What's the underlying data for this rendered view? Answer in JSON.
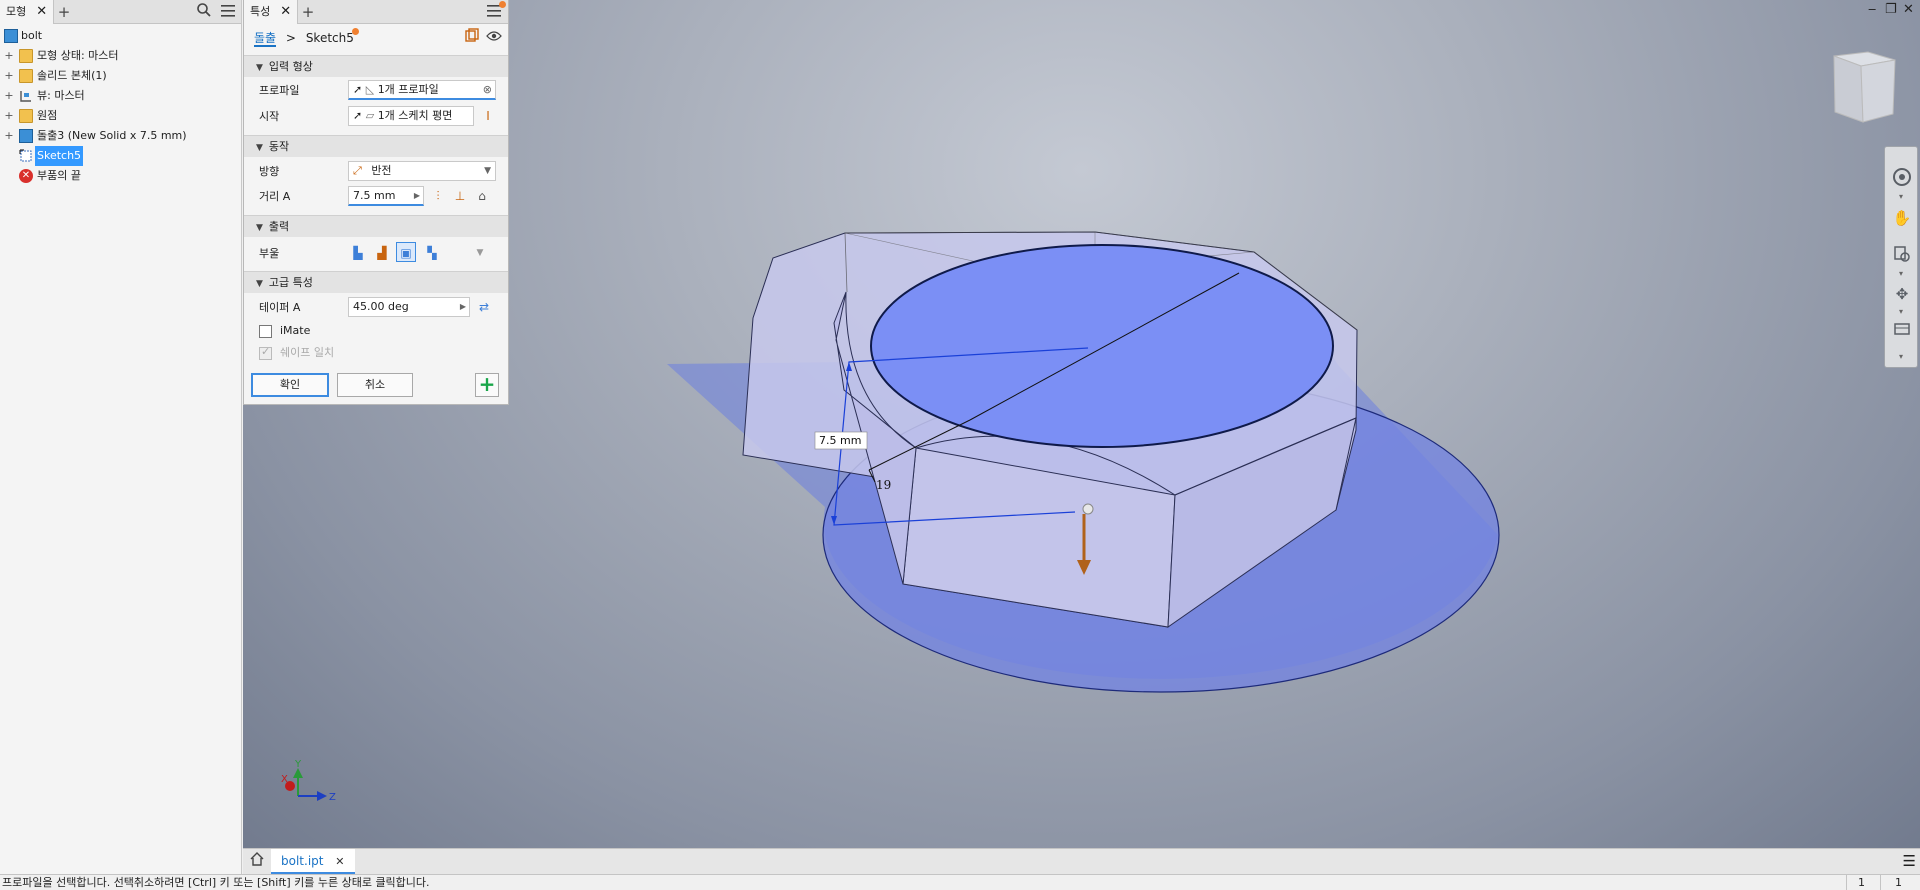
{
  "browser": {
    "tab_label": "모형",
    "close_glyph": "✕",
    "add_glyph": "+",
    "search_icon": "search-icon",
    "menu_icon": "hamburger-icon",
    "tree": [
      {
        "label": "bolt",
        "icon": "part-icon"
      },
      {
        "label": "모형 상태: 마스터",
        "icon": "folder-icon",
        "expand": "+"
      },
      {
        "label": "솔리드 본체(1)",
        "icon": "folder-icon",
        "expand": "+"
      },
      {
        "label": "뷰: 마스터",
        "icon": "view-icon",
        "expand": "+"
      },
      {
        "label": "원점",
        "icon": "folder-icon",
        "expand": "+"
      },
      {
        "label": "돌출3 (New Solid x 7.5 mm)",
        "icon": "extrude-icon",
        "expand": "+"
      },
      {
        "label": "Sketch5",
        "icon": "sketch-icon"
      },
      {
        "label": "부품의 끝",
        "icon": "end-of-part-icon"
      }
    ]
  },
  "properties": {
    "tab_label": "특성",
    "close_glyph": "✕",
    "add_glyph": "+",
    "breadcrumb": {
      "parent": "돌출",
      "separator": ">",
      "current": "Sketch5"
    },
    "sections": {
      "input_geometry": "입력 형상",
      "behavior": "동작",
      "output": "출력",
      "advanced": "고급 특성"
    },
    "profile_label": "프로파일",
    "profile_value": "1개 프로파일",
    "start_label": "시작",
    "start_value": "1개 스케치 평면",
    "direction_label": "방향",
    "direction_value": "반전",
    "distance_label": "거리 A",
    "distance_value": "7.5 mm",
    "boolean_label": "부울",
    "taper_label": "테이퍼 A",
    "taper_value": "45.00 deg",
    "imate_label": "iMate",
    "match_shape_label": "쉐이프 일치",
    "ok_label": "확인",
    "cancel_label": "취소",
    "add_glyph_btn": "+"
  },
  "viewport": {
    "dimension_label": "7.5 mm",
    "diameter_label": "19",
    "axis_x": "X",
    "axis_y": "Y",
    "axis_z": "Z",
    "minimize_glyph": "‒",
    "restore_glyph": "❐",
    "close_glyph": "✕"
  },
  "doctabs": {
    "home_icon": "home-icon",
    "document": "bolt.ipt",
    "close_glyph": "✕",
    "menu_glyph": "☰"
  },
  "status": {
    "message": "프로파일을 선택합니다. 선택취소하려면 [Ctrl] 키 또는 [Shift] 키를 누른 상태로 클릭합니다.",
    "count1": "1",
    "count2": "1"
  },
  "colors": {
    "accent": "#3d8be0",
    "selection": "#3399ff",
    "profile_fill": "#7b8ff5",
    "taper_fill": "#6c7fe0"
  }
}
